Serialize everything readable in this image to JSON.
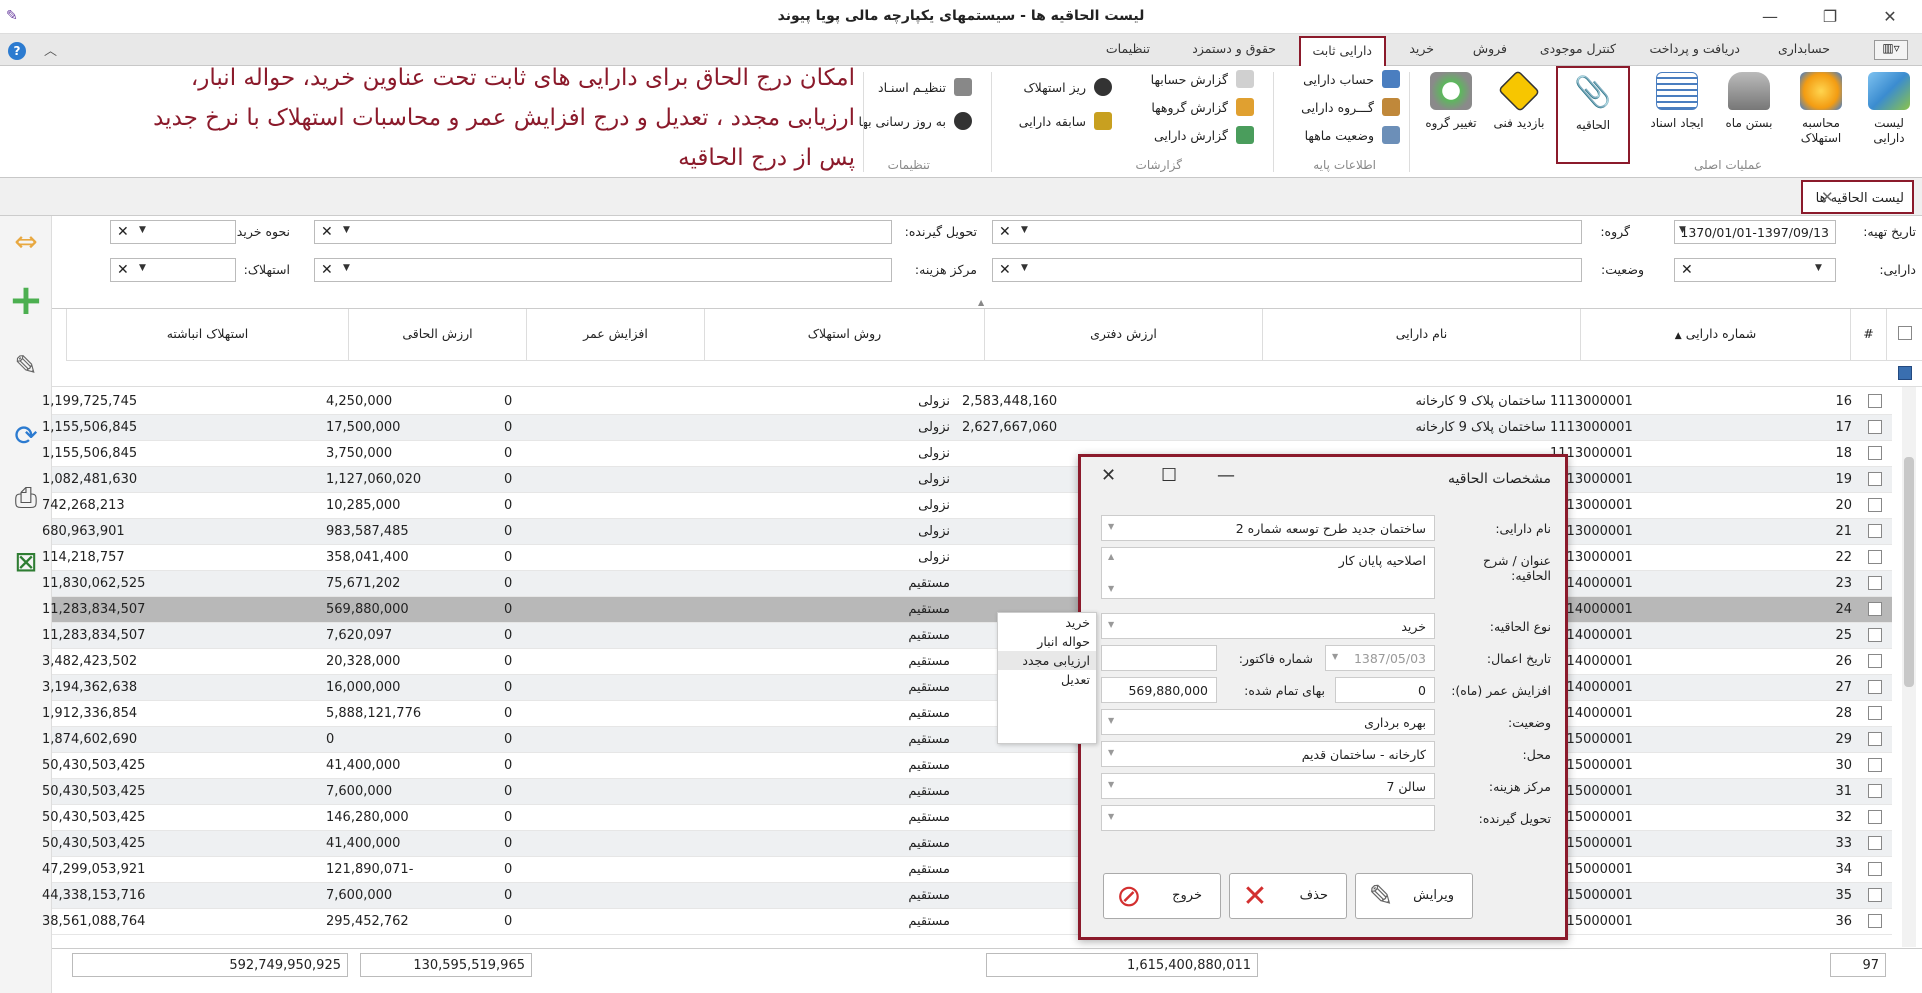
{
  "window": {
    "title": "لیست الحاقیه ها - سیستمهای یکپارچه مالی پویا پیوند",
    "minimize": "—",
    "restore": "❐",
    "close": "✕"
  },
  "menu": {
    "tabs": [
      "حسابداری",
      "دریافت و پرداخت",
      "کنترل موجودی",
      "فروش",
      "خرید",
      "دارایی ثابت",
      "حقوق و دستمزد",
      "تنظیمات"
    ],
    "active": "دارایی ثابت"
  },
  "ribbon": {
    "main_ops": {
      "group": "عملیات اصلی",
      "buttons": [
        "لیست دارایی",
        "محاسبه استهلاک",
        "بستن ماه",
        "ایجاد اسناد",
        "الحاقیه",
        "بازدید فنی",
        "تغییر گروه"
      ]
    },
    "base_info": {
      "group": "اطلاعات پایه",
      "items": [
        "حساب دارایی",
        "گـــروه دارایی",
        "وضعیت ماهها"
      ]
    },
    "reports": {
      "group": "گزارشات",
      "items": [
        "گزارش حسابها",
        "گزارش گروهها",
        "گزارش دارایی",
        "ریز استهلاک",
        "سابقه دارایی"
      ]
    },
    "settings": {
      "group": "تنظیمات",
      "items": [
        "تنظیـم اسنـاد",
        "به روز رسانی بها"
      ]
    }
  },
  "annotation": [
    "امکان درج الحاق برای دارایی های ثابت تحت عناوین خرید، حواله انبار،",
    "ارزیابی مجدد ، تعدیل و درج افزایش عمر و محاسبات استهلاک با نرخ جدید",
    "پس از درج الحاقیه"
  ],
  "doc_tab": {
    "label": "لیست الحاقیه ها",
    "close": "✕"
  },
  "filters": {
    "date_label": "تاریخ تهیه:",
    "date_value": "1370/01/01-1397/09/13",
    "group_label": "گروه:",
    "receiver_label": "تحویل گیرنده:",
    "purchase_label": "نحوه خرید:",
    "asset_label": "دارایی:",
    "status_label": "وضعیت:",
    "cost_center_label": "مرکز هزینه:",
    "depreciation_label": "استهلاک:"
  },
  "grid": {
    "headers": {
      "num": "#",
      "asset_no": "شماره دارایی",
      "asset_name": "نام دارایی",
      "book_value": "ارزش دفتری",
      "method": "روش استهلاک",
      "life_inc": "افزایش عمر",
      "addendum_value": "ارزش الحاقی",
      "acc_dep": "استهلاک انباشته"
    },
    "rows": [
      {
        "num": "16",
        "asset_no": "1113000001",
        "asset_name": "ساختمان پلاک 9 کارخانه",
        "book_value": "2,583,448,160",
        "method": "نزولی",
        "life_inc": "0",
        "addendum_value": "4,250,000",
        "acc_dep": "1,199,725,745"
      },
      {
        "num": "17",
        "asset_no": "1113000001",
        "asset_name": "ساختمان پلاک 9 کارخانه",
        "book_value": "2,627,667,060",
        "method": "نزولی",
        "life_inc": "0",
        "addendum_value": "17,500,000",
        "acc_dep": "1,155,506,845"
      },
      {
        "num": "18",
        "asset_no": "1113000001",
        "asset_name": "",
        "book_value": "",
        "method": "نزولی",
        "life_inc": "0",
        "addendum_value": "3,750,000",
        "acc_dep": "1,155,506,845"
      },
      {
        "num": "19",
        "asset_no": "1113000001",
        "asset_name": "",
        "book_value": "",
        "method": "نزولی",
        "life_inc": "0",
        "addendum_value": "1,127,060,020",
        "acc_dep": "1,082,481,630"
      },
      {
        "num": "20",
        "asset_no": "1113000001",
        "asset_name": "",
        "book_value": "",
        "method": "نزولی",
        "life_inc": "0",
        "addendum_value": "10,285,000",
        "acc_dep": "742,268,213"
      },
      {
        "num": "21",
        "asset_no": "1113000001",
        "asset_name": "",
        "book_value": "",
        "method": "نزولی",
        "life_inc": "0",
        "addendum_value": "983,587,485",
        "acc_dep": "680,963,901"
      },
      {
        "num": "22",
        "asset_no": "1113000001",
        "asset_name": "",
        "book_value": "",
        "method": "نزولی",
        "life_inc": "0",
        "addendum_value": "358,041,400",
        "acc_dep": "114,218,757"
      },
      {
        "num": "23",
        "asset_no": "1114000001",
        "asset_name": "",
        "book_value": "",
        "method": "مستقیم",
        "life_inc": "0",
        "addendum_value": "75,671,202",
        "acc_dep": "11,830,062,525"
      },
      {
        "num": "24",
        "asset_no": "1114000001",
        "asset_name": "",
        "book_value": "",
        "method": "مستقیم",
        "life_inc": "0",
        "addendum_value": "569,880,000",
        "acc_dep": "11,283,834,507"
      },
      {
        "num": "25",
        "asset_no": "1114000001",
        "asset_name": "",
        "book_value": "",
        "method": "مستقیم",
        "life_inc": "0",
        "addendum_value": "7,620,097",
        "acc_dep": "11,283,834,507"
      },
      {
        "num": "26",
        "asset_no": "1114000001",
        "asset_name": "",
        "book_value": "",
        "method": "مستقیم",
        "life_inc": "0",
        "addendum_value": "20,328,000",
        "acc_dep": "3,482,423,502"
      },
      {
        "num": "27",
        "asset_no": "1114000001",
        "asset_name": "",
        "book_value": "",
        "method": "مستقیم",
        "life_inc": "0",
        "addendum_value": "16,000,000",
        "acc_dep": "3,194,362,638"
      },
      {
        "num": "28",
        "asset_no": "1114000001",
        "asset_name": "",
        "book_value": "",
        "method": "مستقیم",
        "life_inc": "0",
        "addendum_value": "5,888,121,776",
        "acc_dep": "1,912,336,854"
      },
      {
        "num": "29",
        "asset_no": "1115000001",
        "asset_name": "",
        "book_value": "",
        "method": "مستقیم",
        "life_inc": "0",
        "addendum_value": "0",
        "acc_dep": "1,874,602,690"
      },
      {
        "num": "30",
        "asset_no": "1115000001",
        "asset_name": "",
        "book_value": "",
        "method": "مستقیم",
        "life_inc": "0",
        "addendum_value": "41,400,000",
        "acc_dep": "50,430,503,425"
      },
      {
        "num": "31",
        "asset_no": "1115000001",
        "asset_name": "",
        "book_value": "",
        "method": "مستقیم",
        "life_inc": "0",
        "addendum_value": "7,600,000",
        "acc_dep": "50,430,503,425"
      },
      {
        "num": "32",
        "asset_no": "1115000001",
        "asset_name": "",
        "book_value": "",
        "method": "مستقیم",
        "life_inc": "0",
        "addendum_value": "146,280,000",
        "acc_dep": "50,430,503,425"
      },
      {
        "num": "33",
        "asset_no": "1115000001",
        "asset_name": "",
        "book_value": "",
        "method": "مستقیم",
        "life_inc": "0",
        "addendum_value": "41,400,000",
        "acc_dep": "50,430,503,425"
      },
      {
        "num": "34",
        "asset_no": "1115000001",
        "asset_name": "",
        "book_value": "",
        "method": "مستقیم",
        "life_inc": "0",
        "addendum_value": "-121,890,071",
        "acc_dep": "47,299,053,921"
      },
      {
        "num": "35",
        "asset_no": "1115000001",
        "asset_name": "",
        "book_value": "",
        "method": "مستقیم",
        "life_inc": "0",
        "addendum_value": "7,600,000",
        "acc_dep": "44,338,153,716"
      },
      {
        "num": "36",
        "asset_no": "1115000001",
        "asset_name": "",
        "book_value": "",
        "method": "مستقیم",
        "life_inc": "0",
        "addendum_value": "295,452,762",
        "acc_dep": "38,561,088,764"
      }
    ],
    "selected_row": "24",
    "totals": {
      "count": "97",
      "book_value": "1,615,400,880,011",
      "addendum_value": "130,595,519,965",
      "acc_dep": "592,749,950,925"
    }
  },
  "dialog": {
    "title": "مشخصات الحاقیه",
    "asset_name_label": "نام دارایی:",
    "asset_name_value": "ساختمان جدید طرح توسعه شماره 2",
    "desc_label": "عنوان / شرح الحاقیه:",
    "desc_value": "اصلاحیه پایان کار",
    "type_label": "نوع الحاقیه:",
    "type_value": "خرید",
    "apply_date_label": "تاریخ اعمال:",
    "apply_date_value": "1387/05/03",
    "invoice_label": "شماره فاکتور:",
    "invoice_value": "",
    "life_inc_label": "افزایش عمر (ماه):",
    "life_inc_value": "0",
    "cost_label": "بهای تمام شده:",
    "cost_value": "569,880,000",
    "status_label": "وضعیت:",
    "status_value": "بهره برداری",
    "location_label": "محل:",
    "location_value": "کارخانه - ساختمان قدیم",
    "cost_center_label": "مرکز هزینه:",
    "cost_center_value": "سالن 7",
    "receiver_label": "تحویل گیرنده:",
    "receiver_value": "",
    "edit": "ویرایش",
    "delete": "حذف",
    "exit": "خروج"
  },
  "type_dropdown": {
    "options": [
      "خرید",
      "حواله انبار",
      "ارزیابی مجدد",
      "تعدیل"
    ],
    "highlighted": "ارزیابی مجدد"
  },
  "colors": {
    "accent": "#8b1a2b",
    "selected_row": "#b8b8b8",
    "alt_row": "#eef0f2"
  }
}
